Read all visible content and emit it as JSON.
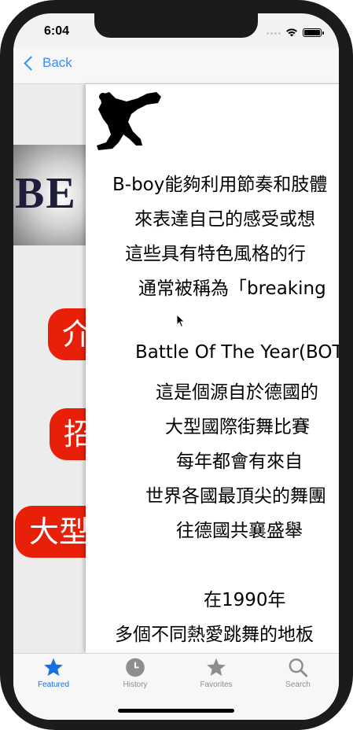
{
  "status_bar": {
    "time": "6:04"
  },
  "nav": {
    "back_label": "Back"
  },
  "background_page": {
    "banner_text": "BE",
    "buttons": [
      "介",
      "招",
      "大型"
    ]
  },
  "article": {
    "lines": [
      "B-boy能夠利用節奏和肢體",
      "來表達自己的感受或想",
      "這些具有特色風格的行",
      "通常被稱為「breaking",
      "",
      "Battle Of The Year(BOT",
      "這是個源自於德國的",
      "大型國際街舞比賽",
      "每年都會有來自",
      "世界各國最頂尖的舞團",
      "往德國共襄盛舉",
      "",
      "在1990年",
      "多個不同熱愛跳舞的地板"
    ]
  },
  "tabs": [
    {
      "label": "Featured",
      "icon": "star-icon",
      "active": true
    },
    {
      "label": "History",
      "icon": "clock-icon",
      "active": false
    },
    {
      "label": "Favorites",
      "icon": "star-icon",
      "active": false
    },
    {
      "label": "Search",
      "icon": "magnifier-icon",
      "active": false
    }
  ],
  "colors": {
    "accent": "#3a8ff0",
    "tab_active": "#1a6fde",
    "button_red": "#e8200a"
  }
}
